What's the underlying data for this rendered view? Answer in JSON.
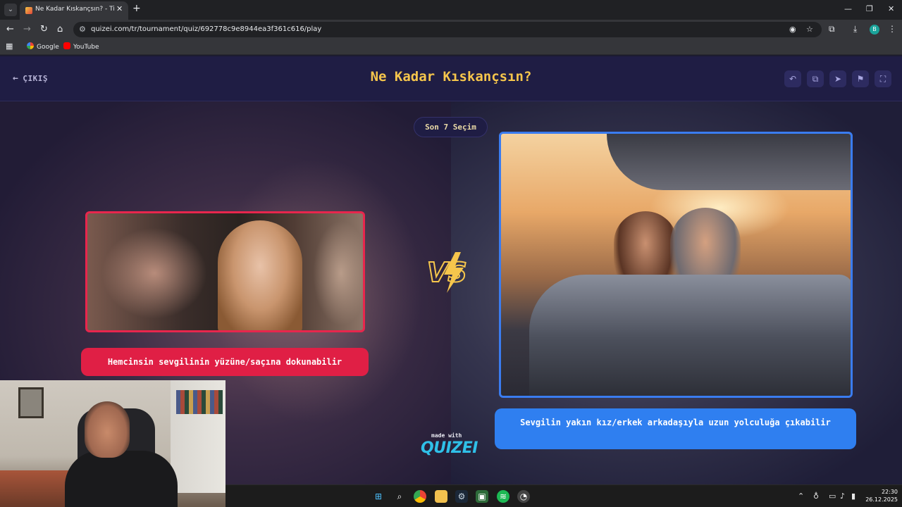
{
  "browser": {
    "tab_title": "Ne Kadar Kıskançsın? - Tier List",
    "url": "quizei.com/tr/tournament/quiz/692778c9e8944ea3f361c616/play",
    "profile_initial": "B",
    "bookmarks": [
      {
        "label": "Google",
        "icon": "google-icon"
      },
      {
        "label": "YouTube",
        "icon": "youtube-icon"
      }
    ]
  },
  "header": {
    "exit_label": "ÇIKIŞ",
    "title": "Ne Kadar Kıskançsın?",
    "buttons": [
      "undo-icon",
      "share-icon",
      "send-icon",
      "flag-icon",
      "fullscreen-icon"
    ]
  },
  "game": {
    "counter": "Son 7 Seçim",
    "left_option": "Hemcinsin sevgilinin yüzüne/saçına dokunabilir",
    "right_option": "Sevgilin yakın kız/erkek arkadaşıyla uzun yolculuğa çıkabilir",
    "vs_text": "VS",
    "left_accent": "#e01f45",
    "right_accent": "#2f7ff0"
  },
  "branding": {
    "made_with": "made with",
    "brand": "QUIZEI"
  },
  "taskbar": {
    "time": "22:30",
    "date": "26.12.2025"
  }
}
